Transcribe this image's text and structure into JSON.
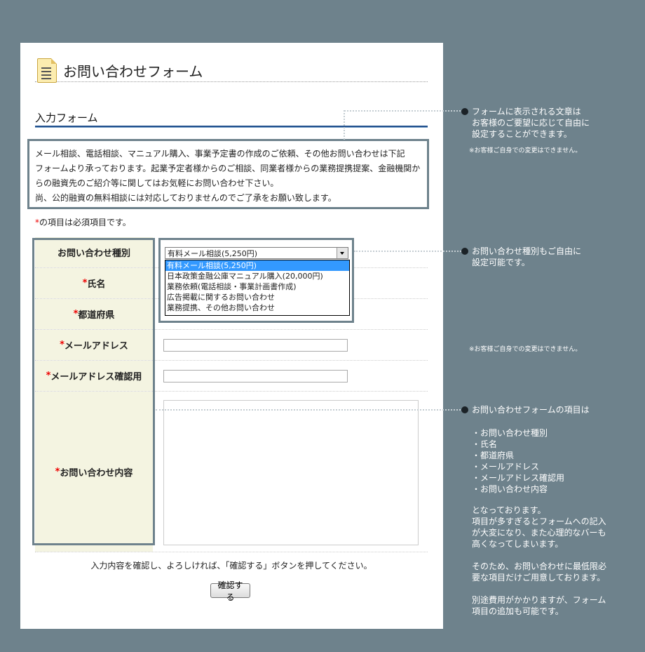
{
  "page_title": "お問い合わせフォーム",
  "section_title": "入力フォーム",
  "intro_lines": [
    "メール相談、電話相談、マニュアル購入、事業予定書の作成のご依頼、その他お問い合わせは下記",
    "フォームより承っております。起業予定者様からのご相談、同業者様からの業務提携提案、金融機関か",
    "らの融資先のご紹介等に関してはお気軽にお問い合わせ下さい。",
    "尚、公的融資の無料相談には対応しておりませんのでご了承をお願い致します。"
  ],
  "required_marker": "*",
  "required_note": "の項目は必須項目です。",
  "form": {
    "inquiry_type_label": "お問い合わせ種別",
    "name_label": "氏名",
    "prefecture_label": "都道府県",
    "email_label": "メールアドレス",
    "email_confirm_label": "メールアドレス確認用",
    "message_label": "お問い合わせ内容",
    "inquiry_selected": "有料メール相談(5,250円)",
    "inquiry_options": [
      "有料メール相談(5,250円)",
      "日本政策金融公庫マニュアル購入(20,000円)",
      "業務依頼(電話相談・事業計画書作成)",
      "広告掲載に関するお問い合わせ",
      "業務提携、その他お問い合わせ"
    ]
  },
  "confirm_instruction": "入力内容を確認し、よろしければ、「確認する」ボタンを押してください。",
  "submit_label": "確認する",
  "annotations": {
    "note1": "フォームに表示される文章は\nお客様のご要望に応じて自由に\n設定することができます。",
    "small_note": "※お客様ご自身での変更はできません。",
    "note2": "お問い合わせ種別もご自由に\n設定可能です。",
    "note3_heading": "お問い合わせフォームの項目は",
    "note3_items": [
      "・お問い合わせ種別",
      "・氏名",
      "・都道府県",
      "・メールアドレス",
      "・メールアドレス確認用",
      "・お問い合わせ内容"
    ],
    "note3_body": "となっております。\n項目が多すぎるとフォームへの記入\nが大変になり、また心理的なバーも\n高くなってしまいます。\n\nそのため、お問い合わせに最低限必\n要な項目だけご用意しております。\n\n別途費用がかかりますが、フォーム\n項目の追加も可能です。"
  },
  "colors": {
    "background": "#6e828c",
    "label_bg": "#f4f4e1",
    "rule_blue": "#1f4e8c",
    "required_red": "#ee0000",
    "select_highlight": "#3399ff"
  }
}
